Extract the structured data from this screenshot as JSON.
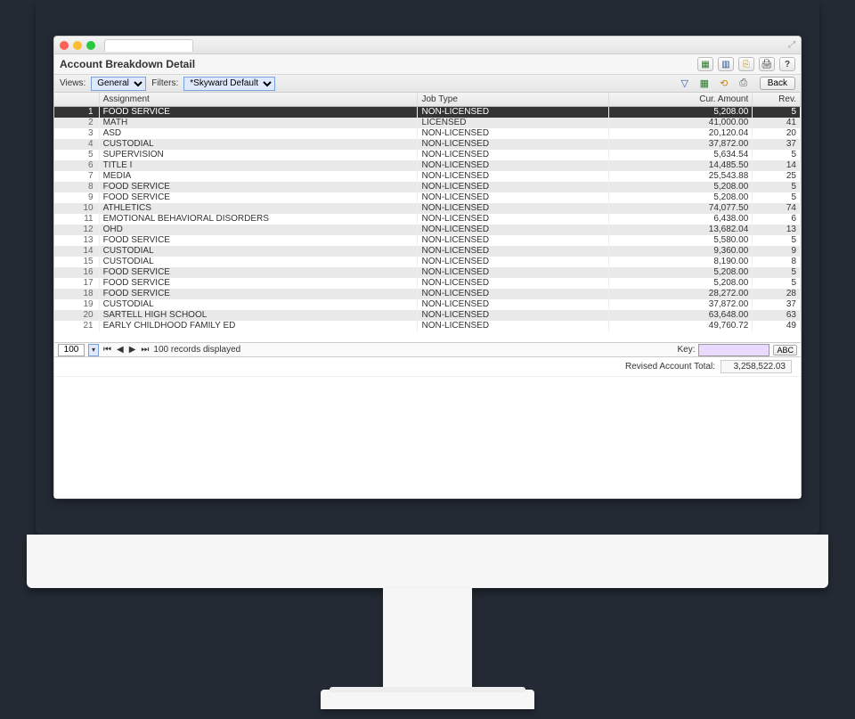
{
  "page_title": "Account Breakdown Detail",
  "toolbar": {
    "views_label": "Views:",
    "views_value": "General",
    "filters_label": "Filters:",
    "filters_value": "*Skyward Default",
    "back_label": "Back"
  },
  "columns": {
    "assignment": "Assignment",
    "job_type": "Job Type",
    "cur_amount": "Cur. Amount",
    "rev": "Rev."
  },
  "rows": [
    {
      "n": 1,
      "assignment": "FOOD SERVICE",
      "job": "NON-LICENSED",
      "cur": "5,208.00",
      "rev": "5"
    },
    {
      "n": 2,
      "assignment": "MATH",
      "job": "LICENSED",
      "cur": "41,000.00",
      "rev": "41"
    },
    {
      "n": 3,
      "assignment": "ASD",
      "job": "NON-LICENSED",
      "cur": "20,120.04",
      "rev": "20"
    },
    {
      "n": 4,
      "assignment": "CUSTODIAL",
      "job": "NON-LICENSED",
      "cur": "37,872.00",
      "rev": "37"
    },
    {
      "n": 5,
      "assignment": "SUPERVISION",
      "job": "NON-LICENSED",
      "cur": "5,634.54",
      "rev": "5"
    },
    {
      "n": 6,
      "assignment": "TITLE I",
      "job": "NON-LICENSED",
      "cur": "14,485.50",
      "rev": "14"
    },
    {
      "n": 7,
      "assignment": "MEDIA",
      "job": "NON-LICENSED",
      "cur": "25,543.88",
      "rev": "25"
    },
    {
      "n": 8,
      "assignment": "FOOD SERVICE",
      "job": "NON-LICENSED",
      "cur": "5,208.00",
      "rev": "5"
    },
    {
      "n": 9,
      "assignment": "FOOD SERVICE",
      "job": "NON-LICENSED",
      "cur": "5,208.00",
      "rev": "5"
    },
    {
      "n": 10,
      "assignment": "ATHLETICS",
      "job": "NON-LICENSED",
      "cur": "74,077.50",
      "rev": "74"
    },
    {
      "n": 11,
      "assignment": "EMOTIONAL BEHAVIORAL DISORDERS",
      "job": "NON-LICENSED",
      "cur": "6,438.00",
      "rev": "6"
    },
    {
      "n": 12,
      "assignment": "OHD",
      "job": "NON-LICENSED",
      "cur": "13,682.04",
      "rev": "13"
    },
    {
      "n": 13,
      "assignment": "FOOD SERVICE",
      "job": "NON-LICENSED",
      "cur": "5,580.00",
      "rev": "5"
    },
    {
      "n": 14,
      "assignment": "CUSTODIAL",
      "job": "NON-LICENSED",
      "cur": "9,360.00",
      "rev": "9"
    },
    {
      "n": 15,
      "assignment": "CUSTODIAL",
      "job": "NON-LICENSED",
      "cur": "8,190.00",
      "rev": "8"
    },
    {
      "n": 16,
      "assignment": "FOOD SERVICE",
      "job": "NON-LICENSED",
      "cur": "5,208.00",
      "rev": "5"
    },
    {
      "n": 17,
      "assignment": "FOOD SERVICE",
      "job": "NON-LICENSED",
      "cur": "5,208.00",
      "rev": "5"
    },
    {
      "n": 18,
      "assignment": "FOOD SERVICE",
      "job": "NON-LICENSED",
      "cur": "28,272.00",
      "rev": "28"
    },
    {
      "n": 19,
      "assignment": "CUSTODIAL",
      "job": "NON-LICENSED",
      "cur": "37,872.00",
      "rev": "37"
    },
    {
      "n": 20,
      "assignment": "SARTELL HIGH SCHOOL",
      "job": "NON-LICENSED",
      "cur": "63,648.00",
      "rev": "63"
    },
    {
      "n": 21,
      "assignment": "EARLY CHILDHOOD FAMILY ED",
      "job": "NON-LICENSED",
      "cur": "49,760.72",
      "rev": "49"
    }
  ],
  "pager": {
    "page_size": "100",
    "status": "100 records displayed",
    "key_label": "Key:",
    "key_btn": "ABC"
  },
  "total": {
    "label": "Revised Account Total:",
    "value": "3,258,522.03"
  }
}
